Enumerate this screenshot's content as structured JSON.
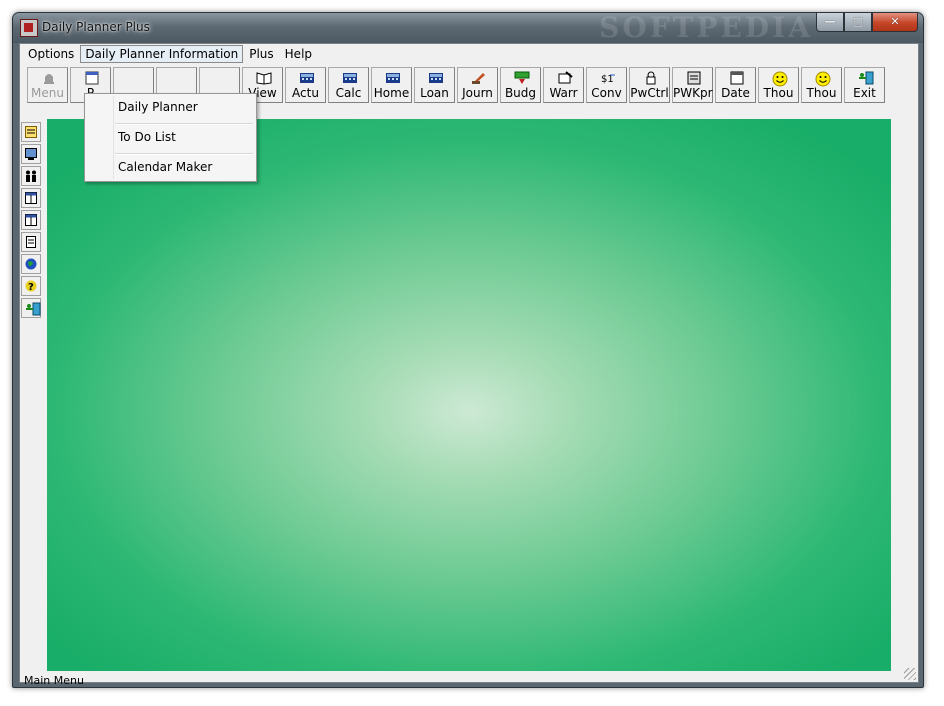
{
  "window": {
    "title": "Daily Planner Plus",
    "watermark": "SOFTPEDIA"
  },
  "window_buttons": [
    "minimize-icon",
    "maximize-icon",
    "close-icon"
  ],
  "menubar": {
    "items": [
      {
        "label": "Options"
      },
      {
        "label": "Daily Planner Information",
        "active": true
      },
      {
        "label": "Plus"
      },
      {
        "label": "Help"
      }
    ]
  },
  "toolbar": {
    "buttons": [
      {
        "label": "Menu",
        "icon": "bell-icon",
        "disabled": true
      },
      {
        "label": "P",
        "icon": "planner-icon"
      },
      {
        "label": "",
        "icon": "blank-icon"
      },
      {
        "label": "",
        "icon": "blank-icon"
      },
      {
        "label": "",
        "icon": "blank-icon"
      },
      {
        "label": "View",
        "icon": "book-icon"
      },
      {
        "label": "Actu",
        "icon": "calculator-icon"
      },
      {
        "label": "Calc",
        "icon": "calculator-icon"
      },
      {
        "label": "Home",
        "icon": "calculator-icon"
      },
      {
        "label": "Loan",
        "icon": "calculator-icon"
      },
      {
        "label": "Journ",
        "icon": "pen-icon"
      },
      {
        "label": "Budg",
        "icon": "money-icon"
      },
      {
        "label": "Warr",
        "icon": "certificate-icon"
      },
      {
        "label": "Conv",
        "icon": "convert-icon"
      },
      {
        "label": "PwCtrl",
        "icon": "lock-icon"
      },
      {
        "label": "PWKpr",
        "icon": "keeper-icon"
      },
      {
        "label": "Date",
        "icon": "calendar-icon"
      },
      {
        "label": "Thou",
        "icon": "smiley-icon"
      },
      {
        "label": "Thou",
        "icon": "smiley-icon"
      },
      {
        "label": "Exit",
        "icon": "exit-icon"
      }
    ]
  },
  "sidebar": {
    "icons": [
      "note-icon",
      "monitor-icon",
      "people-icon",
      "table-icon",
      "table-icon",
      "list-icon",
      "globe-icon",
      "question-icon",
      "exit-icon"
    ]
  },
  "dropdown": {
    "items": [
      {
        "label": "Daily Planner"
      },
      {
        "label": "To Do List"
      },
      {
        "label": "Calendar Maker"
      }
    ]
  },
  "status": {
    "text": "Main Menu"
  },
  "colors": {
    "canvas_center": "#cde9d4",
    "canvas_edge": "#18ad68"
  }
}
